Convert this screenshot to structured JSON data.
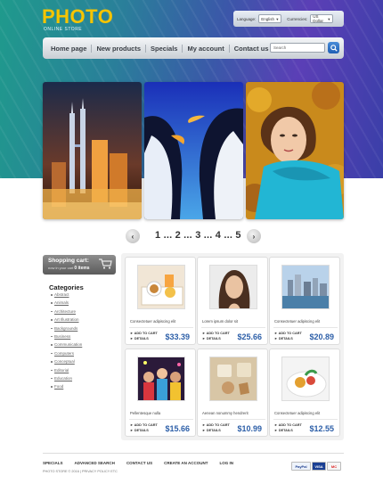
{
  "logo": {
    "title": "PHOTO",
    "subtitle": "ONLINE STORE"
  },
  "selectors": {
    "language_label": "Language:",
    "language_value": "English",
    "currency_label": "Currencies:",
    "currency_value": "US Dollar"
  },
  "nav": {
    "items": [
      "Home page",
      "New products",
      "Specials",
      "My account",
      "Contact us"
    ]
  },
  "search": {
    "placeholder": "Search"
  },
  "pager": {
    "prev": "‹",
    "next": "›",
    "pages": "1 ... 2 ... 3 ... 4 ... 5"
  },
  "cart": {
    "title": "Shopping cart:",
    "sub_prefix": "now in your cart",
    "count": "0 items"
  },
  "categories": {
    "title": "Categories",
    "items": [
      "Abstract",
      "Animals",
      "Architecture",
      "Art Illustration",
      "Backgrounds",
      "Business",
      "Communication",
      "Computers",
      "Conceptual",
      "Editorial",
      "Education",
      "Food"
    ]
  },
  "products": [
    {
      "name": "Consectetuer adipiscing elit",
      "price": "$33.39",
      "add": "ADD TO CART",
      "details": "DETAILS",
      "image": "breakfast-tray"
    },
    {
      "name": "Lorem ipsum dolor sit",
      "price": "$25.66",
      "add": "ADD TO CART",
      "details": "DETAILS",
      "image": "woman-portrait"
    },
    {
      "name": "Consectetuer adipiscing elit",
      "price": "$20.89",
      "add": "ADD TO CART",
      "details": "DETAILS",
      "image": "city-harbor"
    },
    {
      "name": "Pellentesque nulla",
      "price": "$15.66",
      "add": "ADD TO CART",
      "details": "DETAILS",
      "image": "party-crowd"
    },
    {
      "name": "Aenean nonummy hendrerit",
      "price": "$10.99",
      "add": "ADD TO CART",
      "details": "DETAILS",
      "image": "spa-shells"
    },
    {
      "name": "Consectetuer adipiscing elit",
      "price": "$12.55",
      "add": "ADD TO CART",
      "details": "DETAILS",
      "image": "food-plate"
    }
  ],
  "footer": {
    "links": [
      "SPECIALS",
      "ADVANCED SEARCH",
      "CONTACT US",
      "CREATE AN ACCOUNT",
      "LOG IN"
    ],
    "copyright": "PHOTO STORE © 2016 | PRIVACY POLICY ETC",
    "payments": [
      "PayPal",
      "VISA",
      "MC"
    ]
  },
  "colors": {
    "logo": "#f6c400",
    "price": "#2d5fa8",
    "nav_text": "#3a3f46"
  }
}
